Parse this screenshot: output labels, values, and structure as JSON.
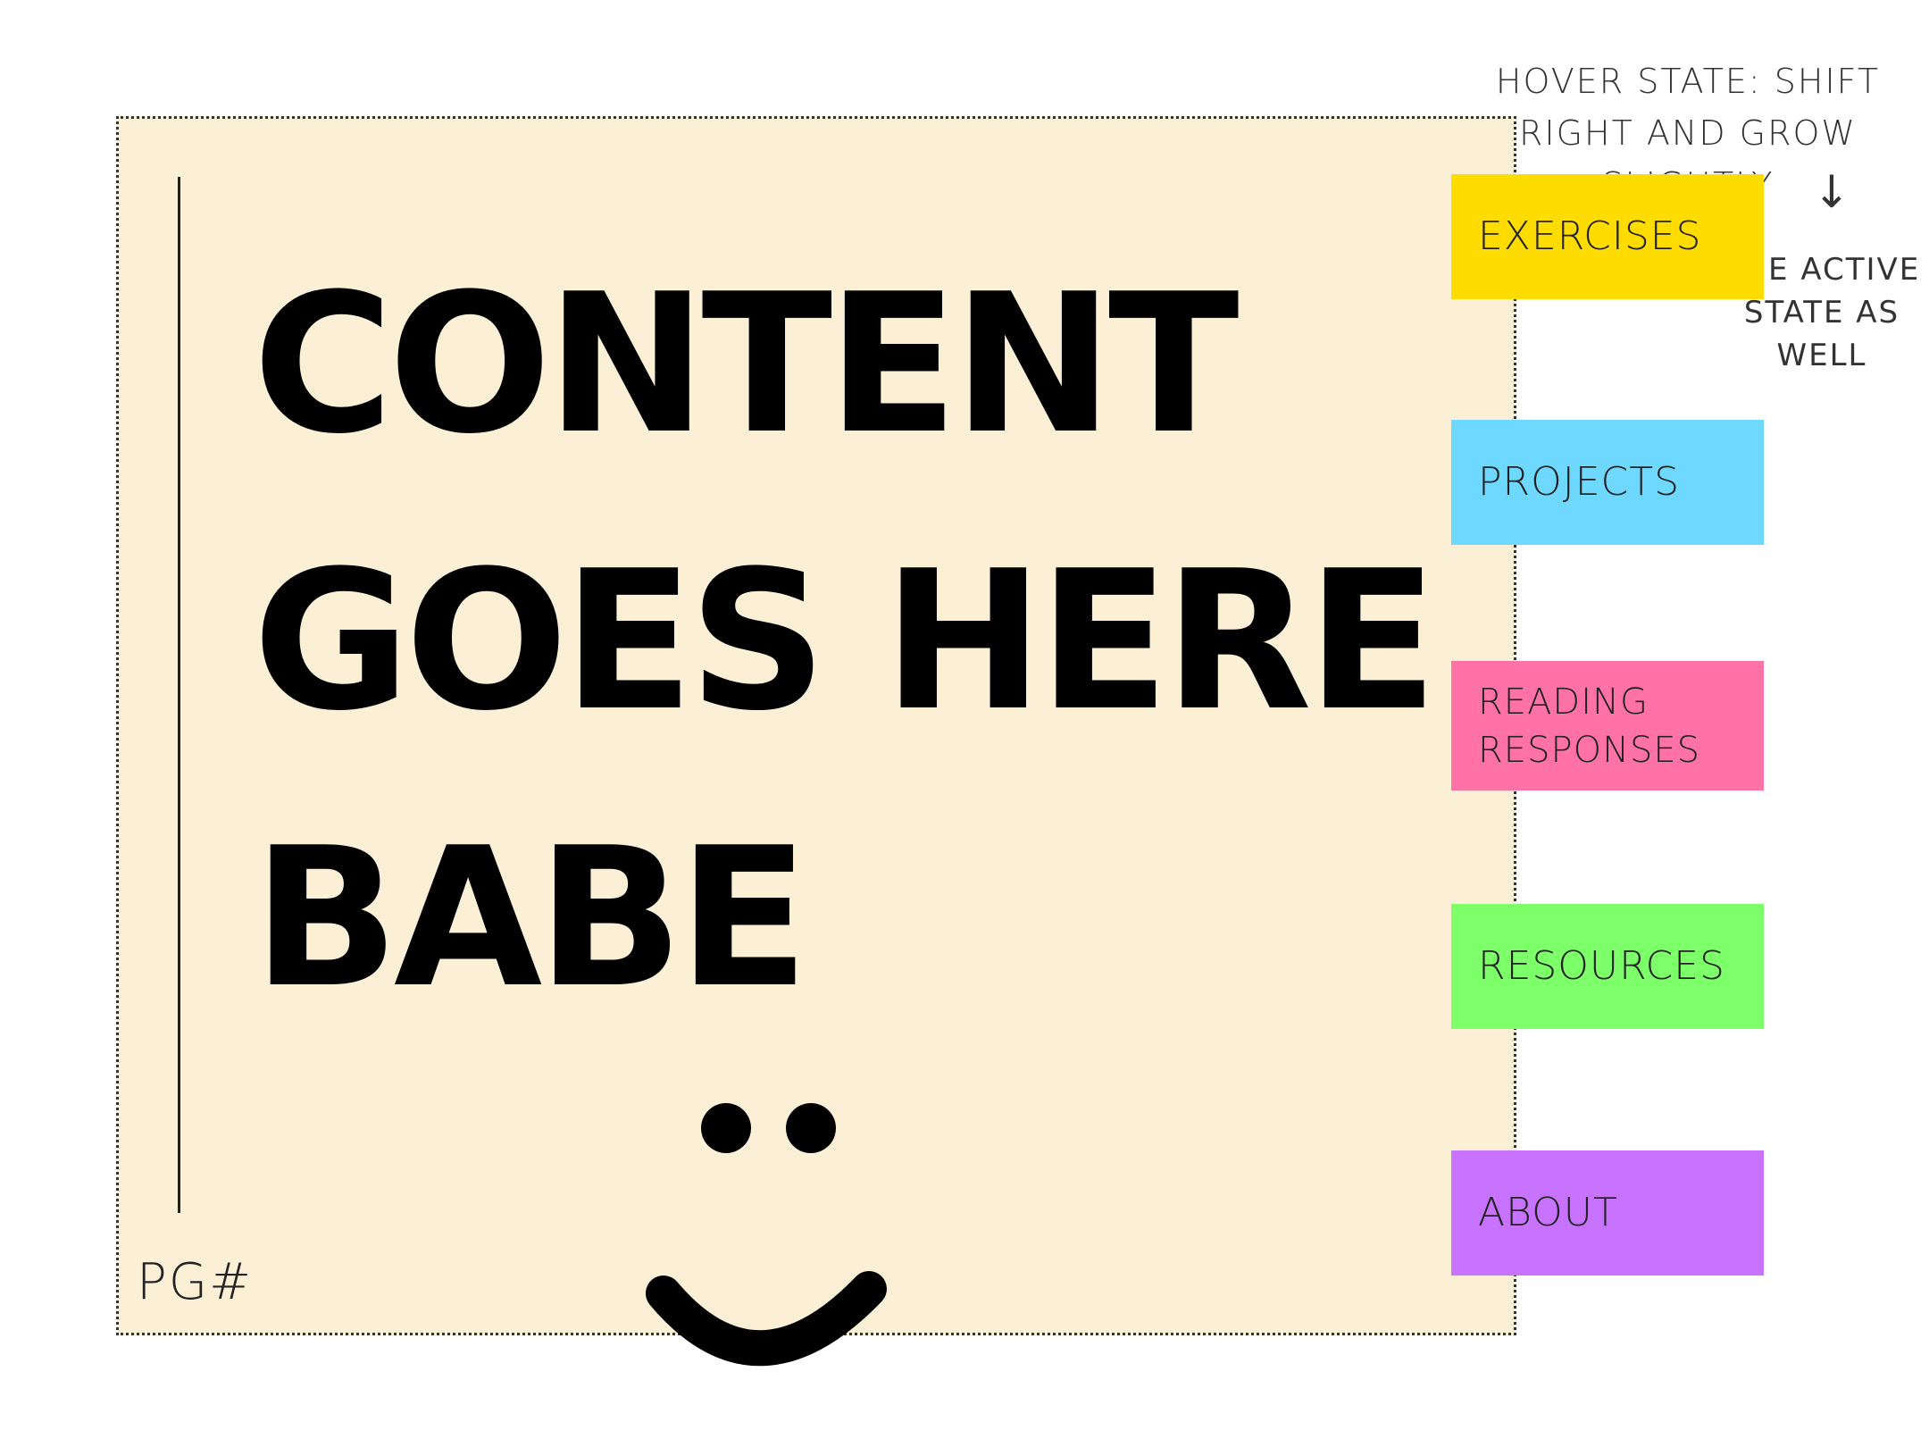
{
  "annotations": {
    "hover_note": "HOVER STATE: SHIFT RIGHT AND GROW SLIGHTLY",
    "arrow": "↓",
    "active_note": "THE ACTIVE STATE AS WELL"
  },
  "page": {
    "headline": "CONTENT GOES HERE BABE",
    "page_number": "PG#"
  },
  "tabs": [
    {
      "label": "Exercises",
      "color": "#ffdc00"
    },
    {
      "label": "Projects",
      "color": "#6fd8ff"
    },
    {
      "label": "Reading Responses",
      "color": "#ff72a6"
    },
    {
      "label": "Resources",
      "color": "#7dff6a"
    },
    {
      "label": "About",
      "color": "#c873ff"
    }
  ],
  "colors": {
    "page_background": "#fbefd6",
    "ink": "#000000"
  },
  "icons": {
    "face": "smiley-face-icon",
    "arrow": "down-arrow-icon"
  }
}
